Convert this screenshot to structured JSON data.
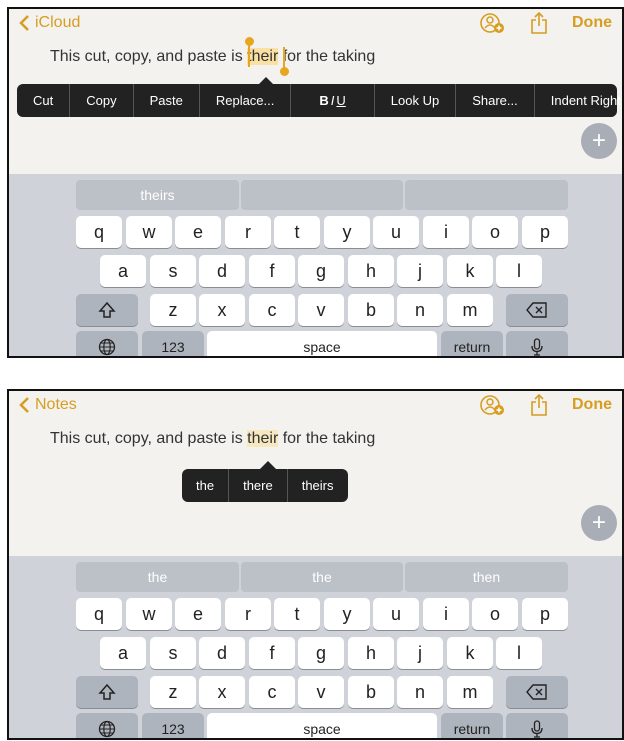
{
  "panel1": {
    "nav": {
      "back_label": "iCloud",
      "done_label": "Done"
    },
    "note": {
      "before": "This cut, copy, and paste is ",
      "selected": "their",
      "after": " for the taking"
    },
    "edit_menu": [
      "Cut",
      "Copy",
      "Paste",
      "Replace...",
      "BIU",
      "Look Up",
      "Share...",
      "Indent Right"
    ],
    "predictions": [
      "theirs",
      "",
      ""
    ]
  },
  "panel2": {
    "nav": {
      "back_label": "Notes",
      "done_label": "Done"
    },
    "note": {
      "before": "This cut, copy, and paste is ",
      "selected": "their",
      "after": " for the taking"
    },
    "suggestions": [
      "the",
      "there",
      "theirs"
    ],
    "predictions": [
      "the",
      "the",
      "then"
    ]
  },
  "keyboard": {
    "row1": [
      "q",
      "w",
      "e",
      "r",
      "t",
      "y",
      "u",
      "i",
      "o",
      "p"
    ],
    "row2": [
      "a",
      "s",
      "d",
      "f",
      "g",
      "h",
      "j",
      "k",
      "l"
    ],
    "row3": [
      "z",
      "x",
      "c",
      "v",
      "b",
      "n",
      "m"
    ],
    "numbers_label": "123",
    "space_label": "space",
    "return_label": "return"
  },
  "icons": {
    "back": "chevron-left-icon",
    "collaborate": "add-person-icon",
    "share": "share-icon",
    "fab": "plus-icon",
    "shift": "shift-icon",
    "delete": "delete-icon",
    "globe": "globe-icon",
    "mic": "microphone-icon"
  },
  "colors": {
    "accent": "#d79d21",
    "selection": "#f6e8bf",
    "menu": "#222222",
    "keyboard": "#cfd3d9"
  }
}
